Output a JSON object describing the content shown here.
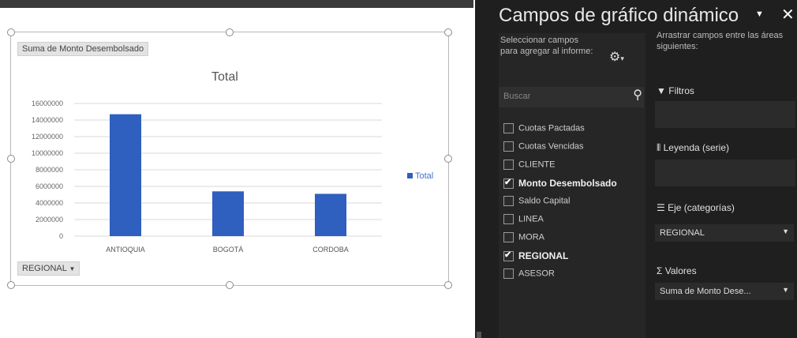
{
  "chart": {
    "value_button": "Suma de Monto Desembolsado",
    "axis_field_button": "REGIONAL",
    "axis_field_arrow": "▼"
  },
  "chart_data": {
    "type": "bar",
    "title": "Total",
    "categories": [
      "ANTIOQUIA",
      "BOGOTÁ",
      "CORDOBA"
    ],
    "series": [
      {
        "name": "Total",
        "values": [
          14700000,
          5400000,
          5100000
        ],
        "color": "#2f5fbf"
      }
    ],
    "y_ticks": [
      "16000000",
      "14000000",
      "12000000",
      "10000000",
      "8000000",
      "6000000",
      "4000000",
      "2000000",
      "0"
    ],
    "ylim": [
      0,
      16000000
    ],
    "grid": true,
    "legend": "right"
  },
  "panel": {
    "title": "Campos de gráfico dinámico",
    "dropdown_icon": "▼",
    "close_icon": "✕",
    "select_hint": "Seleccionar campos para agregar al informe:",
    "gear_icon": "gear-icon",
    "search_placeholder": "Buscar",
    "drag_hint": "Arrastrar campos entre las áreas siguientes:",
    "fields": [
      {
        "label": "Cuotas Pactadas",
        "checked": false
      },
      {
        "label": "Cuotas Vencidas",
        "checked": false
      },
      {
        "label": "CLIENTE",
        "checked": false
      },
      {
        "label": "Monto Desembolsado",
        "checked": true
      },
      {
        "label": "Saldo Capital",
        "checked": false
      },
      {
        "label": "LINEA",
        "checked": false
      },
      {
        "label": "MORA",
        "checked": false
      },
      {
        "label": "REGIONAL",
        "checked": true
      },
      {
        "label": "ASESOR",
        "checked": false
      }
    ],
    "areas": {
      "filters": "Filtros",
      "legend": "Leyenda (serie)",
      "axis": "Eje (categorías)",
      "axis_item": "REGIONAL",
      "values": "Valores",
      "values_item": "Suma de Monto Dese..."
    }
  }
}
